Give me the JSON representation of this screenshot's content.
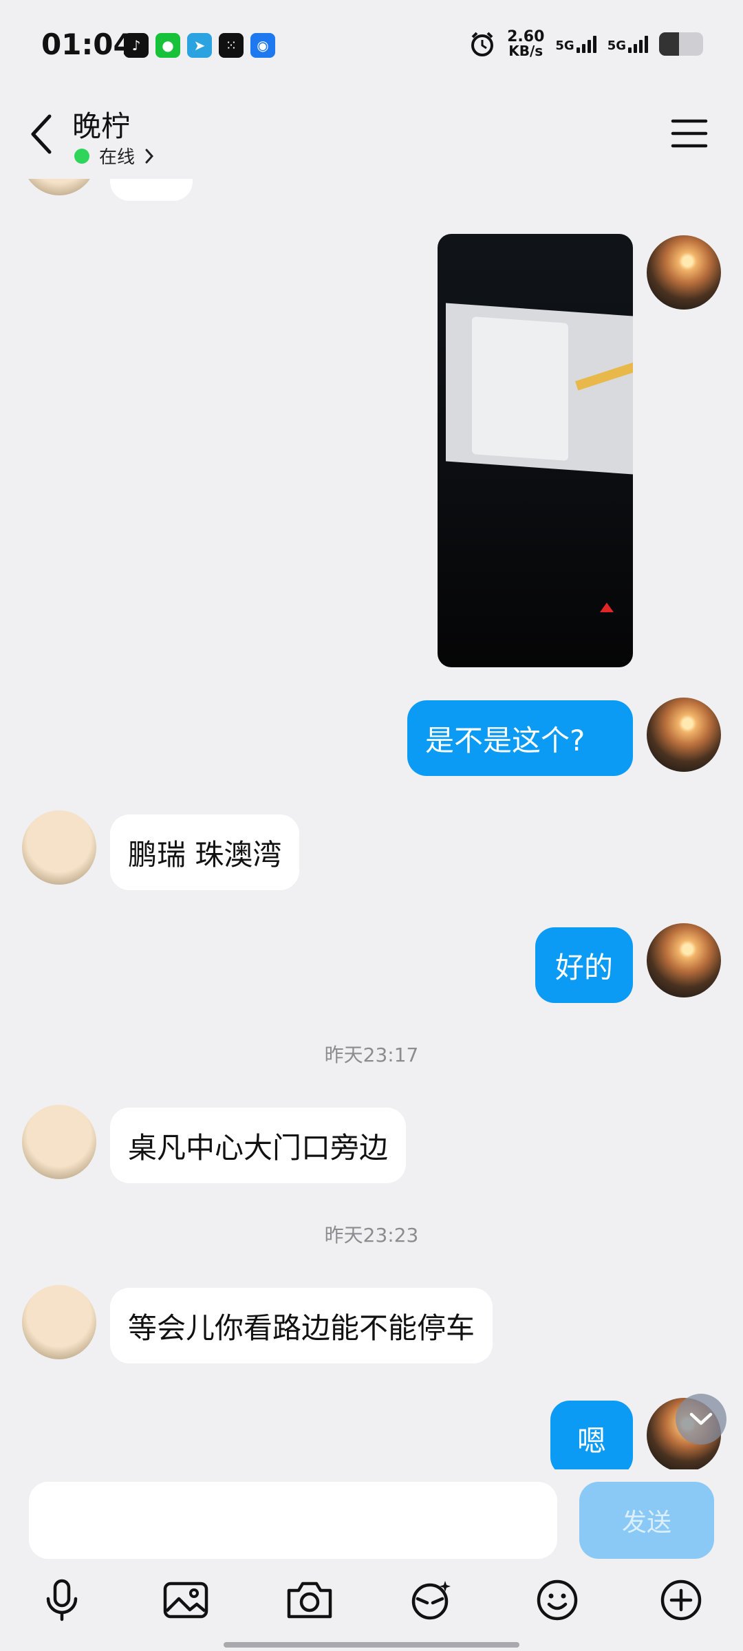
{
  "status_bar": {
    "time": "01:04",
    "net_speed_value": "2.60",
    "net_speed_unit": "KB/s",
    "signal_1": "5G",
    "signal_2": "5G",
    "battery_level": 0.45
  },
  "header": {
    "contact_name": "晚柠",
    "status": "在线"
  },
  "messages": {
    "m1": "是不是这个?",
    "m2": "鹏瑞 珠澳湾",
    "m3": "好的",
    "ts1": "昨天23:17",
    "m4": "桌凡中心大门口旁边",
    "ts2": "昨天23:23",
    "m5": "等会儿你看路边能不能停车",
    "m6": "嗯"
  },
  "input": {
    "placeholder": "",
    "send_label": "发送"
  },
  "colors": {
    "outgoing_bubble": "#0b9bf5",
    "incoming_bubble": "#ffffff",
    "send_button": "#8ac8f5",
    "online_dot": "#2fd45a"
  },
  "icons": {
    "toolbar": [
      "microphone-icon",
      "image-icon",
      "camera-icon",
      "ai-face-icon",
      "emoji-icon",
      "plus-icon"
    ]
  }
}
